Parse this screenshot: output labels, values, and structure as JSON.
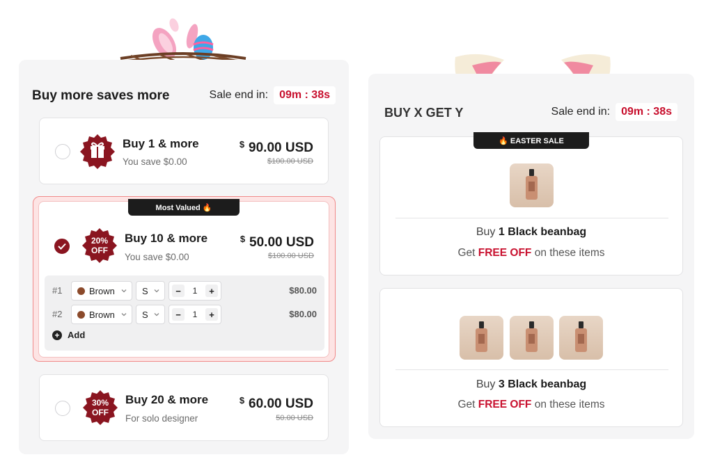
{
  "left_panel": {
    "title": "Buy more saves more",
    "sale_label": "Sale end in:",
    "timer": "09m : 38s",
    "tiers": [
      {
        "title": "Buy 1 & more",
        "subtitle": "You save $0.00",
        "currency": "$",
        "price": "90.00 USD",
        "old_price": "$100.00 USD",
        "icon": "gift-icon",
        "selected": false
      },
      {
        "title": "Buy 10 & more",
        "subtitle": "You save $0.00",
        "currency": "$",
        "price": "50.00 USD",
        "old_price": "$100.00 USD",
        "badge_line1": "20%",
        "badge_line2": "OFF",
        "selected": true,
        "ribbon": "Most Valued 🔥"
      },
      {
        "title": "Buy 20 & more",
        "subtitle": "For solo designer",
        "currency": "$",
        "price": "60.00 USD",
        "old_price": "50.00 USD",
        "badge_line1": "30%",
        "badge_line2": "OFF",
        "selected": false
      }
    ],
    "variants": [
      {
        "index": "#1",
        "color": "Brown",
        "size": "S",
        "qty": "1",
        "price": "$80.00"
      },
      {
        "index": "#2",
        "color": "Brown",
        "size": "S",
        "qty": "1",
        "price": "$80.00"
      }
    ],
    "add_label": "Add",
    "minus": "−",
    "plus": "+"
  },
  "right_panel": {
    "title": "BUY X GET Y",
    "sale_label": "Sale end in:",
    "timer": "09m : 38s",
    "ribbon": "🔥 EASTER SALE",
    "offers": [
      {
        "buy_prefix": "Buy ",
        "buy_bold": "1 Black beanbag",
        "get_prefix": "Get ",
        "get_free": "FREE OFF",
        "get_suffix": " on these items"
      },
      {
        "buy_prefix": "Buy ",
        "buy_bold": "3 Black beanbag",
        "get_prefix": "Get ",
        "get_free": "FREE OFF",
        "get_suffix": " on these items"
      }
    ]
  },
  "colors": {
    "accent": "#8a1520",
    "timer_red": "#c8102e",
    "highlight_border": "#f08a8a"
  }
}
